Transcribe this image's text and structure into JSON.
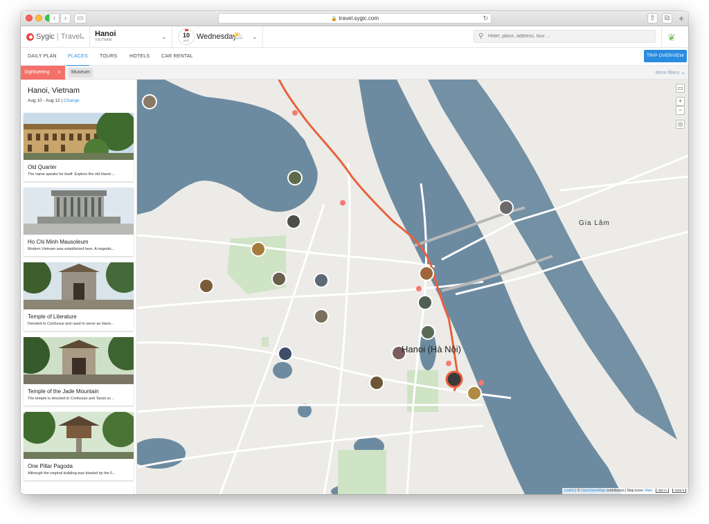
{
  "browser": {
    "url": "travel.sygic.com"
  },
  "header": {
    "brand": "Sygic",
    "brand_product": "Travel",
    "destination_city": "Hanoi",
    "destination_country": "VIETNAM",
    "date_day": "10",
    "date_month": "AUG",
    "weekday": "Wednesday",
    "search_placeholder": "Hotel, place, address, tour ..."
  },
  "nav": {
    "tabs": [
      {
        "label": "DAILY PLAN"
      },
      {
        "label": "PLACES"
      },
      {
        "label": "TOURS"
      },
      {
        "label": "HOTELS"
      },
      {
        "label": "CAR RENTAL"
      }
    ],
    "active_tab": "PLACES",
    "trip_overview": "TRIP OVERVIEW"
  },
  "filters": {
    "active": "Sightseeing",
    "close": "×",
    "chip": "Museum",
    "more": "More filters"
  },
  "sidebar": {
    "title": "Hanoi, Vietnam",
    "dates": "Aug 10 - Aug 12 |",
    "change": "Change",
    "places": [
      {
        "name": "Old Quarter",
        "desc": "The name speaks for itself. Explore the old Hanoi ..."
      },
      {
        "name": "Ho Chi Minh Mausoleum",
        "desc": "Modern Vietnam was established here. A majestic..."
      },
      {
        "name": "Temple of Literature",
        "desc": "Devoted to Confucius and used to serve as Hano..."
      },
      {
        "name": "Temple of the Jade Mountain",
        "desc": "The temple is devoted to Confucian and Taoist sc..."
      },
      {
        "name": "One Pillar Pagoda",
        "desc": "Although the original building was blasted by the F..."
      }
    ]
  },
  "map": {
    "place_labels": [
      {
        "text": "Hanoi (Hà Nội)"
      },
      {
        "text": "Gia Lâm"
      }
    ],
    "attribution_leaflet": "Leaflet",
    "attribution_sep": " | © ",
    "attribution_osm": "OpenStreetMap",
    "attribution_rest": " contributors | Map icons: ",
    "attribution_maki": "Maki",
    "scale_m": "300 m",
    "scale_ft": "1000 ft",
    "controls": {
      "zoom_in": "+",
      "zoom_out": "−"
    }
  },
  "colors": {
    "accent": "#2a8ce0",
    "active_filter": "#f47068",
    "route": "#e8603c",
    "water": "#6d8ba0",
    "park": "#cfe3c5",
    "land": "#ecebe7"
  }
}
